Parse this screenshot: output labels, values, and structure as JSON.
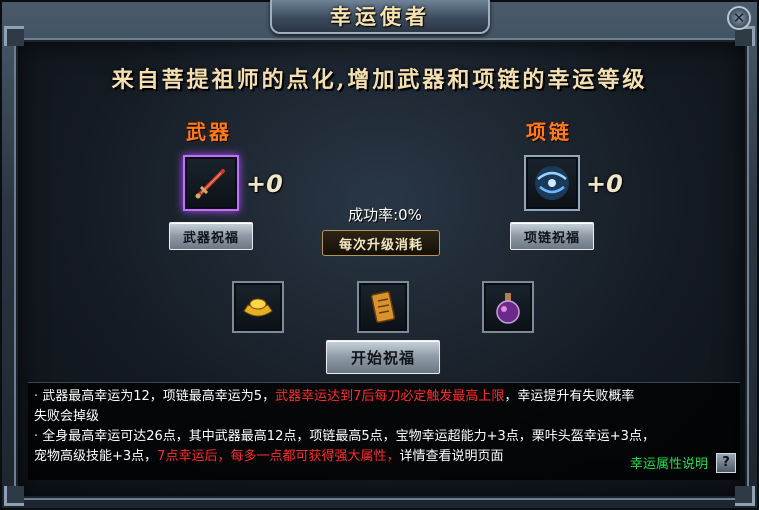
{
  "window": {
    "title": "幸运使者",
    "close_icon": "close-icon"
  },
  "headline": "来自菩提祖师的点化,增加武器和项链的幸运等级",
  "weapon": {
    "label": "武器",
    "bonus": "+0",
    "button": "武器祝福",
    "icon": "sword-icon"
  },
  "necklace": {
    "label": "项链",
    "bonus": "+0",
    "button": "项链祝福",
    "icon": "necklace-icon"
  },
  "upgrade": {
    "success_rate": "成功率:0%",
    "cost_label": "每次升级消耗",
    "start_button": "开始祝福"
  },
  "materials": [
    {
      "icon": "gold-ingot-icon"
    },
    {
      "icon": "scroll-icon"
    },
    {
      "icon": "potion-icon"
    }
  ],
  "info": {
    "line1_a": "武器最高幸运为12，项链最高幸运为5，",
    "line1_red": "武器幸运达到7后每刀必定触发最高上限",
    "line1_b": "，幸运提升有失败概率",
    "line2": "失败会掉级",
    "line3": "全身最高幸运可达26点，其中武器最高12点，项链最高5点，宝物幸运超能力+3点，栗咔头盔幸运+3点，",
    "line4_a": "宠物高级技能+3点，",
    "line4_red": "7点幸运后，每多一点都可获得强大属性，",
    "line4_b": "详情查看说明页面",
    "help_link": "幸运属性说明",
    "help_button": "?"
  },
  "colors": {
    "accent_orange": "#ff7a1a",
    "warning_red": "#ff2a2a",
    "link_green": "#1fe04a",
    "title_gold": "#f7e3b0"
  }
}
